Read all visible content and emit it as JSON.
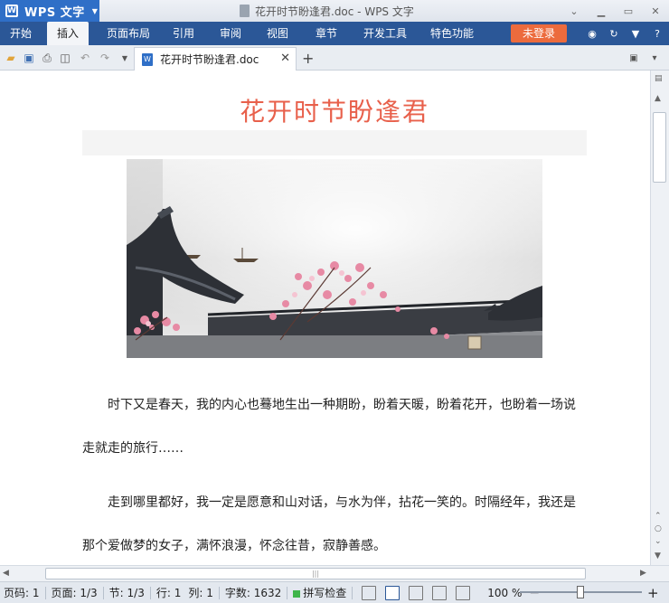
{
  "app": {
    "name": "WPS 文字",
    "window_title": "花开时节盼逢君.doc - WPS 文字"
  },
  "menu": {
    "items": [
      "开始",
      "插入",
      "页面布局",
      "引用",
      "审阅",
      "视图",
      "章节",
      "开发工具",
      "特色功能"
    ],
    "active": "插入",
    "login": "未登录"
  },
  "toolbar": {
    "doc_tab_label": "花开时节盼逢君.doc"
  },
  "document": {
    "title": "花开时节盼逢君",
    "paragraphs": [
      "时下又是春天，我的内心也蓦地生出一种期盼，盼着天暖，盼着花开，也盼着一场说走就走的旅行……",
      "走到哪里都好，我一定是愿意和山对话，与水为伴，拈花一笑的。时隔经年，我还是那个爱做梦的女子，满怀浪漫，怀念往昔，寂静善感。"
    ],
    "image_alt": "水墨古建筑与桃花"
  },
  "status": {
    "page_code": "页码: 1",
    "page": "页面: 1/3",
    "section": "节: 1/3",
    "row": "行: 1",
    "col": "列: 1",
    "words": "字数: 1632",
    "spell_check": "拼写检查",
    "zoom": "100 %"
  },
  "colors": {
    "accent": "#2b5797",
    "title_red": "#e8604b",
    "login": "#ec6b3d"
  }
}
